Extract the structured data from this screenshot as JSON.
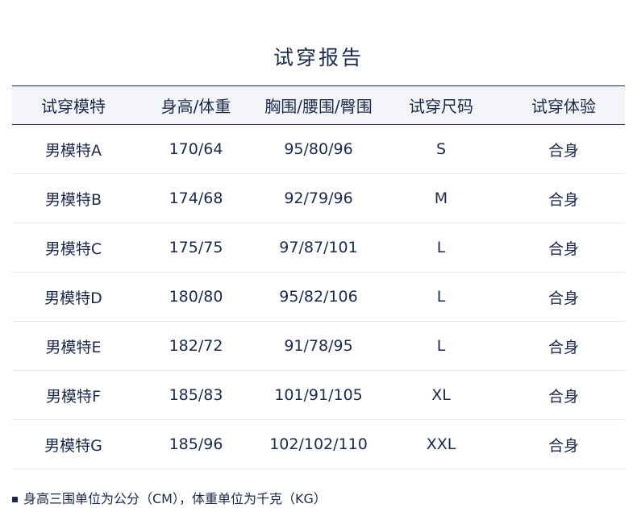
{
  "title": "试穿报告",
  "table": {
    "headers": [
      "试穿模特",
      "身高/体重",
      "胸围/腰围/臀围",
      "试穿尺码",
      "试穿体验"
    ],
    "rows": [
      [
        "男模特A",
        "170/64",
        "95/80/96",
        "S",
        "合身"
      ],
      [
        "男模特B",
        "174/68",
        "92/79/96",
        "M",
        "合身"
      ],
      [
        "男模特C",
        "175/75",
        "97/87/101",
        "L",
        "合身"
      ],
      [
        "男模特D",
        "180/80",
        "95/82/106",
        "L",
        "合身"
      ],
      [
        "男模特E",
        "182/72",
        "91/78/95",
        "L",
        "合身"
      ],
      [
        "男模特F",
        "185/83",
        "101/91/105",
        "XL",
        "合身"
      ],
      [
        "男模特G",
        "185/96",
        "102/102/110",
        "XXL",
        "合身"
      ]
    ]
  },
  "note": "身高三围单位为公分（CM），体重单位为千克（KG）"
}
